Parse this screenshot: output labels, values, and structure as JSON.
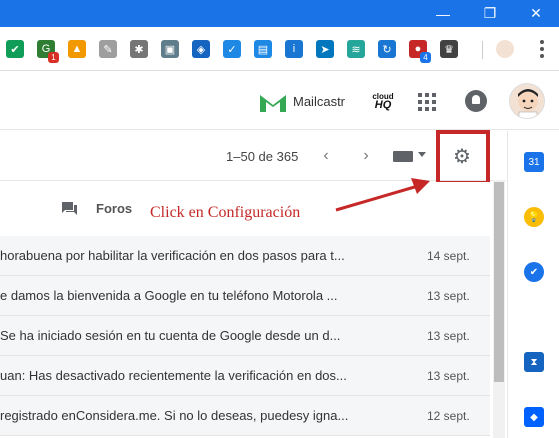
{
  "window": {
    "minimize": "—",
    "maximize": "❐",
    "close": "✕"
  },
  "extensions": [
    {
      "name": "check",
      "color": "#0f9d58",
      "glyph": "✔",
      "badge": ""
    },
    {
      "name": "grammar",
      "color": "#2e7d32",
      "glyph": "G",
      "badge": "1",
      "badge_color": "#d93025"
    },
    {
      "name": "stats",
      "color": "#f29900",
      "glyph": "▲",
      "badge": ""
    },
    {
      "name": "pen",
      "color": "#9e9e9e",
      "glyph": "✎",
      "badge": ""
    },
    {
      "name": "puzzle",
      "color": "#757575",
      "glyph": "✱",
      "badge": ""
    },
    {
      "name": "image",
      "color": "#607d8b",
      "glyph": "▣",
      "badge": ""
    },
    {
      "name": "download",
      "color": "#1565c0",
      "glyph": "◈",
      "badge": ""
    },
    {
      "name": "check-box",
      "color": "#1e88e5",
      "glyph": "✓",
      "badge": ""
    },
    {
      "name": "clipboard",
      "color": "#1e88e5",
      "glyph": "▤",
      "badge": ""
    },
    {
      "name": "info",
      "color": "#1976d2",
      "glyph": "i",
      "badge": ""
    },
    {
      "name": "send",
      "color": "#0277bd",
      "glyph": "➤",
      "badge": ""
    },
    {
      "name": "audio",
      "color": "#26a69a",
      "glyph": "≋",
      "badge": ""
    },
    {
      "name": "sync",
      "color": "#1976d2",
      "glyph": "↻",
      "badge": ""
    },
    {
      "name": "record",
      "color": "#c62828",
      "glyph": "●",
      "badge": "4",
      "badge_color": "#1a73e8"
    },
    {
      "name": "crown",
      "color": "#424242",
      "glyph": "♛",
      "badge": ""
    }
  ],
  "header": {
    "mailcastr_label": "Mailcastr",
    "cloudhq_line1": "cloud",
    "cloudhq_line2": "HQ"
  },
  "toolbar": {
    "paging": "1–50 de 365",
    "prev": "‹",
    "next": "›",
    "settings_glyph": "⚙"
  },
  "tabs": {
    "forums_label": "Foros"
  },
  "annotation": {
    "text": "Click en Configuración",
    "color": "#c62828"
  },
  "mails": [
    {
      "subject": "horabuena por habilitar la verificación en dos pasos para t...",
      "date": "14 sept."
    },
    {
      "subject": "e damos la bienvenida a Google en tu teléfono Motorola ...",
      "date": "13 sept."
    },
    {
      "subject": "Se ha iniciado sesión en tu cuenta de Google desde un d...",
      "date": "13 sept."
    },
    {
      "subject": "uan: Has desactivado recientemente la verificación en dos...",
      "date": "13 sept."
    },
    {
      "subject": "registrado enConsidera.me. Si no lo deseas, puedesy igna...",
      "date": "12 sept."
    }
  ],
  "sidepanel": [
    {
      "name": "calendar",
      "color": "#1a73e8",
      "glyph": "31"
    },
    {
      "name": "keep",
      "color": "#fbbc04",
      "glyph": "💡"
    },
    {
      "name": "tasks",
      "color": "#1a73e8",
      "glyph": "✔"
    },
    {
      "name": "hubspot",
      "color": "#1565c0",
      "glyph": "⧗"
    },
    {
      "name": "dropbox",
      "color": "#0061fe",
      "glyph": "◆"
    }
  ]
}
